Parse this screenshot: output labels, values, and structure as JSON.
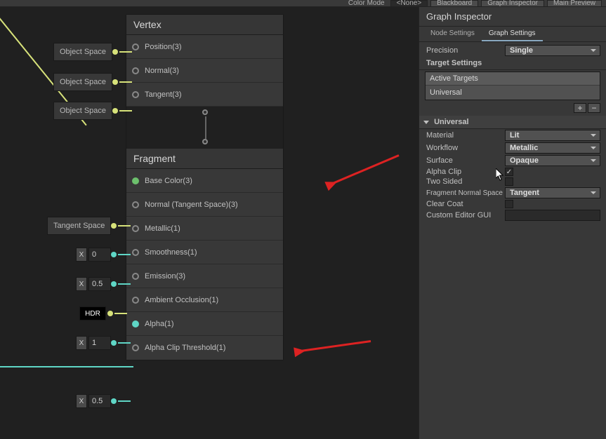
{
  "toolbar": {
    "color_mode_label": "Color Mode",
    "color_mode_value": "<None>",
    "buttons": [
      "Blackboard",
      "Graph Inspector",
      "Main Preview"
    ]
  },
  "node": {
    "vertex_title": "Vertex",
    "fragment_title": "Fragment",
    "vertex_rows": [
      {
        "pill": "Object Space",
        "label": "Position(3)",
        "wire": "yellow"
      },
      {
        "pill": "Object Space",
        "label": "Normal(3)",
        "wire": "yellow"
      },
      {
        "pill": "Object Space",
        "label": "Tangent(3)",
        "wire": "yellow"
      }
    ],
    "fragment_rows": [
      {
        "pill": null,
        "label": "Base Color(3)",
        "wire": null,
        "filled": true
      },
      {
        "pill": "Tangent Space",
        "label": "Normal (Tangent Space)(3)",
        "wire": "yellow"
      },
      {
        "x": true,
        "val": "0",
        "label": "Metallic(1)",
        "wire": "teal"
      },
      {
        "x": true,
        "val": "0.5",
        "label": "Smoothness(1)",
        "wire": "teal"
      },
      {
        "hdr": "HDR",
        "label": "Emission(3)",
        "wire": "yellow"
      },
      {
        "x": true,
        "val": "1",
        "label": "Ambient Occlusion(1)",
        "wire": "teal"
      },
      {
        "pill": null,
        "label": "Alpha(1)",
        "wire": null,
        "filled": true
      },
      {
        "x": true,
        "val": "0.5",
        "label": "Alpha Clip Threshold(1)",
        "wire": "teal"
      }
    ]
  },
  "inspector": {
    "title": "Graph Inspector",
    "tabs": {
      "node": "Node Settings",
      "graph": "Graph Settings"
    },
    "precision_label": "Precision",
    "precision_value": "Single",
    "target_settings_label": "Target Settings",
    "active_targets_label": "Active Targets",
    "active_targets_item": "Universal",
    "add": "+",
    "remove": "−",
    "universal_header": "Universal",
    "props": {
      "material_label": "Material",
      "material_value": "Lit",
      "workflow_label": "Workflow",
      "workflow_value": "Metallic",
      "surface_label": "Surface",
      "surface_value": "Opaque",
      "alpha_clip_label": "Alpha Clip",
      "alpha_clip_checked": "✓",
      "two_sided_label": "Two Sided",
      "fns_label": "Fragment Normal Space",
      "fns_value": "Tangent",
      "clear_coat_label": "Clear Coat",
      "custom_gui_label": "Custom Editor GUI"
    }
  }
}
